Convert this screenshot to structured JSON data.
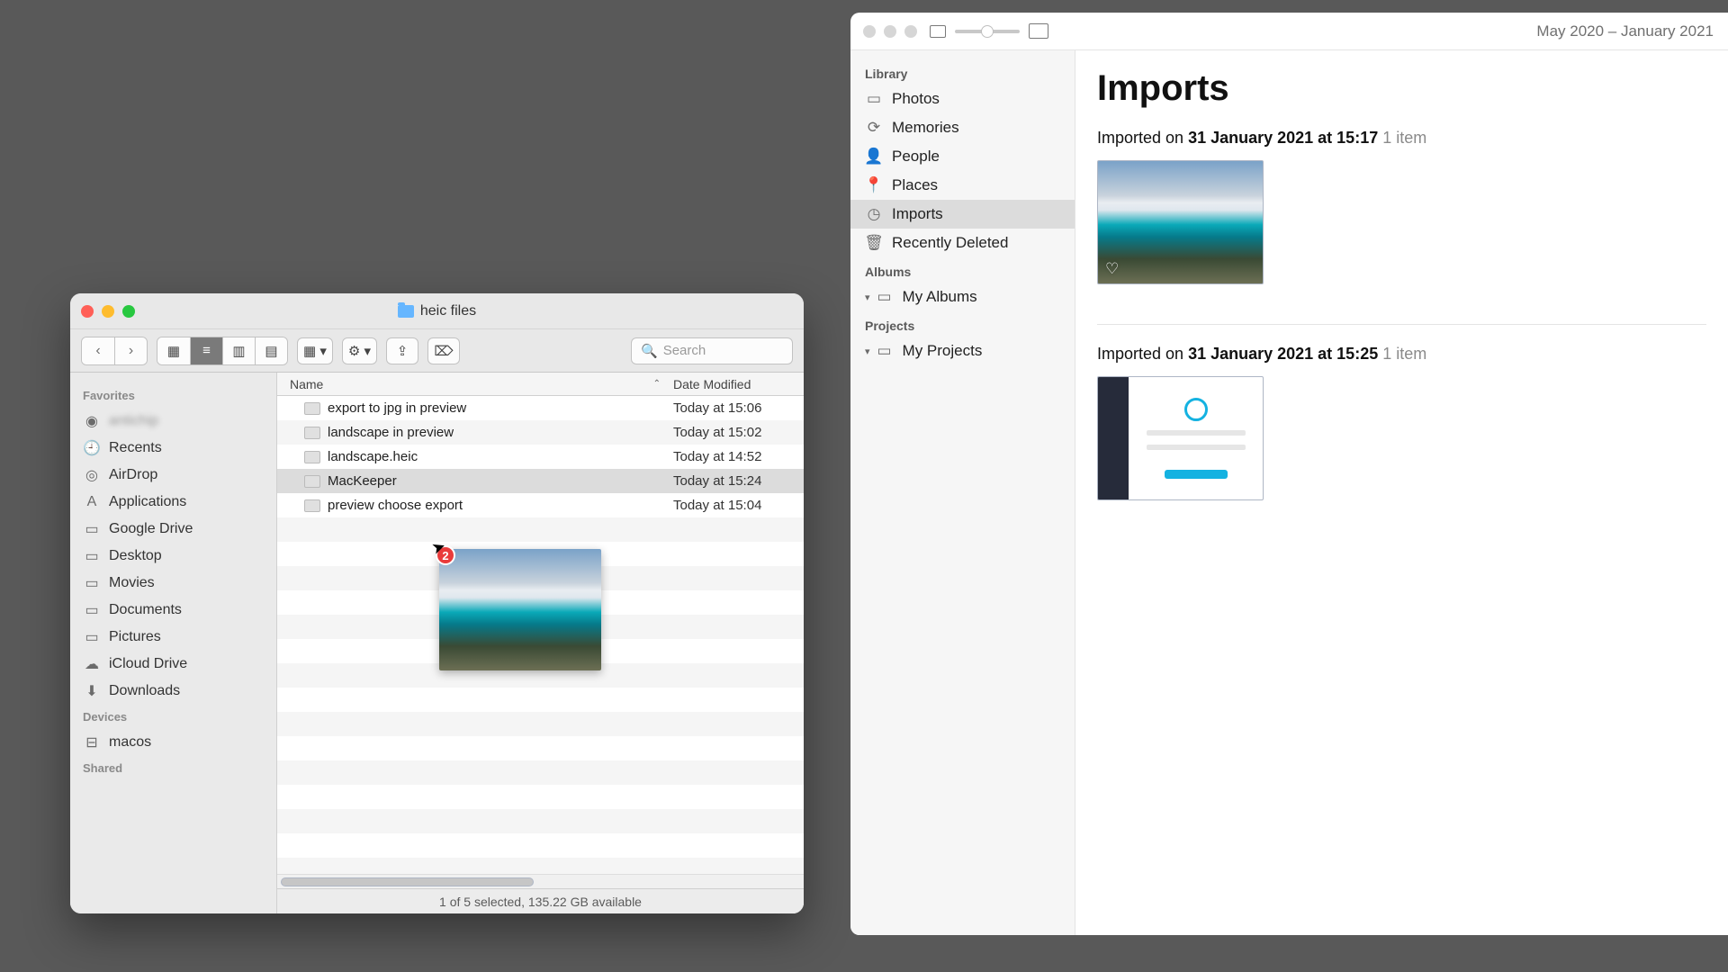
{
  "finder": {
    "title": "heic files",
    "search_placeholder": "Search",
    "sidebar": {
      "favorites_title": "Favorites",
      "devices_title": "Devices",
      "shared_title": "Shared",
      "items": [
        {
          "icon": "user-icon",
          "glyph": "◉",
          "name": "antichip",
          "blurred": true
        },
        {
          "icon": "recents-icon",
          "glyph": "🕘",
          "name": "Recents"
        },
        {
          "icon": "airdrop-icon",
          "glyph": "◎",
          "name": "AirDrop"
        },
        {
          "icon": "applications-icon",
          "glyph": "A",
          "name": "Applications"
        },
        {
          "icon": "folder-icon",
          "glyph": "▭",
          "name": "Google Drive"
        },
        {
          "icon": "desktop-icon",
          "glyph": "▭",
          "name": "Desktop"
        },
        {
          "icon": "movies-icon",
          "glyph": "▭",
          "name": "Movies"
        },
        {
          "icon": "documents-icon",
          "glyph": "▭",
          "name": "Documents"
        },
        {
          "icon": "pictures-icon",
          "glyph": "▭",
          "name": "Pictures"
        },
        {
          "icon": "icloud-icon",
          "glyph": "☁",
          "name": "iCloud Drive"
        },
        {
          "icon": "downloads-icon",
          "glyph": "⬇",
          "name": "Downloads"
        }
      ],
      "devices": [
        {
          "icon": "disk-icon",
          "glyph": "⊟",
          "name": "macos"
        }
      ]
    },
    "columns": {
      "name": "Name",
      "date": "Date Modified"
    },
    "rows": [
      {
        "name": "export to jpg in preview",
        "date": "Today at 15:06",
        "selected": false
      },
      {
        "name": "landscape in preview",
        "date": "Today at 15:02",
        "selected": false
      },
      {
        "name": "landscape.heic",
        "date": "Today at 14:52",
        "selected": false
      },
      {
        "name": "MacKeeper",
        "date": "Today at 15:24",
        "selected": true
      },
      {
        "name": "preview choose export",
        "date": "Today at 15:04",
        "selected": false
      }
    ],
    "drag_badge": "2",
    "status": "1 of 5 selected, 135.22 GB available"
  },
  "photos": {
    "date_range": "May 2020 – January 2021",
    "page_title": "Imports",
    "sidebar": {
      "library_title": "Library",
      "albums_title": "Albums",
      "projects_title": "Projects",
      "library": [
        {
          "icon": "photos-icon",
          "name": "Photos"
        },
        {
          "icon": "memories-icon",
          "name": "Memories"
        },
        {
          "icon": "people-icon",
          "name": "People"
        },
        {
          "icon": "places-icon",
          "name": "Places"
        },
        {
          "icon": "imports-icon",
          "name": "Imports",
          "selected": true
        },
        {
          "icon": "trash-icon",
          "name": "Recently Deleted"
        }
      ],
      "my_albums": "My Albums",
      "my_projects": "My Projects"
    },
    "imports": [
      {
        "prefix": "Imported on ",
        "date": "31 January 2021 at 15:17",
        "count": "1 item",
        "thumb": "landscape"
      },
      {
        "prefix": "Imported on ",
        "date": "31 January 2021 at 15:25",
        "count": "1 item",
        "thumb": "app"
      }
    ]
  }
}
